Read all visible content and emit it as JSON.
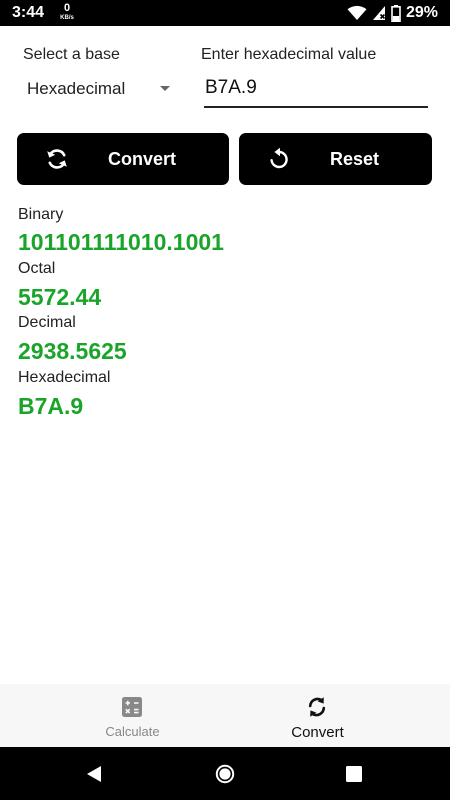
{
  "status_bar": {
    "time": "3:44",
    "net_speed_value": "0",
    "net_speed_unit": "KB/s",
    "battery_percent": "29%",
    "icons": [
      "wifi-icon",
      "signal-icon",
      "battery-icon"
    ]
  },
  "form": {
    "base_label": "Select a base",
    "base_selected": "Hexadecimal",
    "input_label": "Enter hexadecimal value",
    "input_value": "B7A.9"
  },
  "buttons": {
    "convert_label": "Convert",
    "convert_icon": "refresh-icon",
    "reset_label": "Reset",
    "reset_icon": "reset-icon"
  },
  "results": [
    {
      "label": "Binary",
      "value": "101101111010.1001"
    },
    {
      "label": "Octal",
      "value": "5572.44"
    },
    {
      "label": "Decimal",
      "value": "2938.5625"
    },
    {
      "label": "Hexadecimal",
      "value": "B7A.9"
    }
  ],
  "bottom_nav": {
    "items": [
      {
        "label": "Calculate",
        "icon": "calculator-icon",
        "active": false
      },
      {
        "label": "Convert",
        "icon": "convert-icon",
        "active": true
      }
    ]
  },
  "colors": {
    "result_value": "#1aa52a",
    "button_bg": "#000000",
    "nav_bg": "#f7f7f7"
  }
}
